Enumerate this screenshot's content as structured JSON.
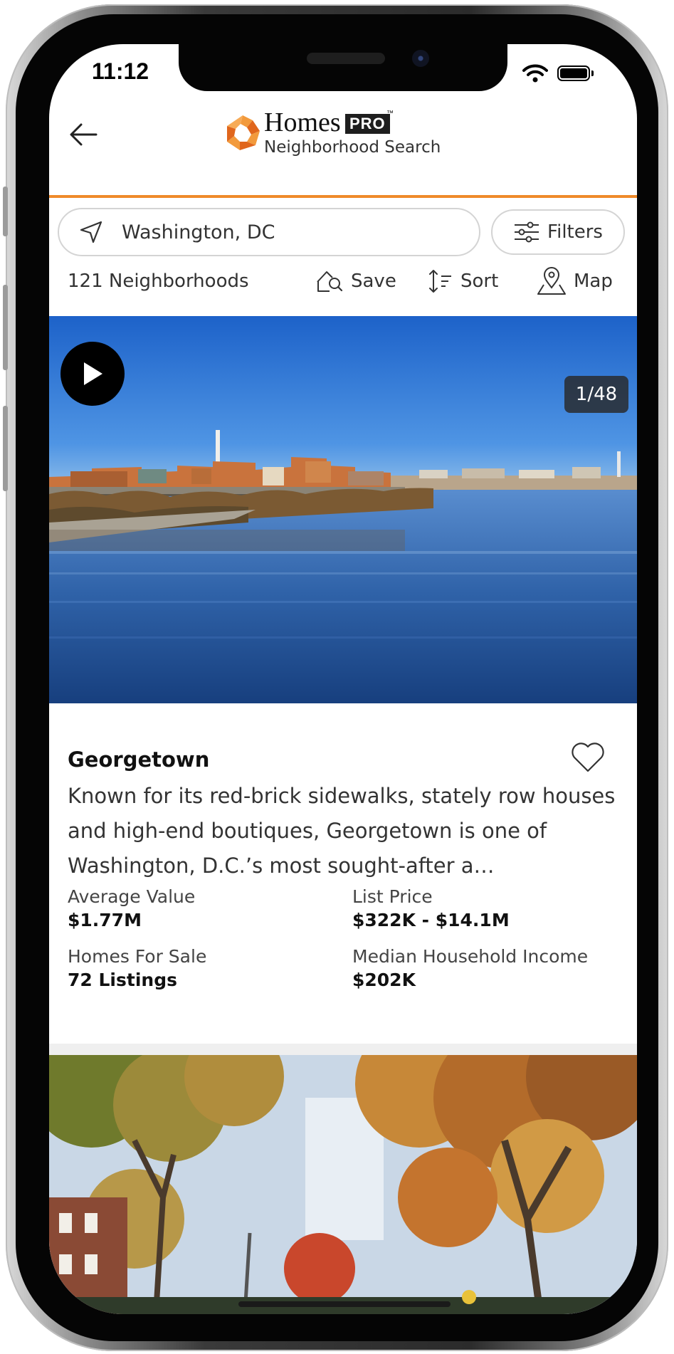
{
  "status_bar": {
    "time": "11:12"
  },
  "header": {
    "brand_name": "Homes",
    "brand_badge": "PRO",
    "brand_tm": "™",
    "subtitle": "Neighborhood Search"
  },
  "search": {
    "value": "Washington, DC",
    "filters_label": "Filters"
  },
  "toolbar": {
    "count": "121 Neighborhoods",
    "save_label": "Save",
    "sort_label": "Sort",
    "map_label": "Map"
  },
  "listing": {
    "photo_counter": "1/48",
    "name": "Georgetown",
    "description": "Known for its red-brick sidewalks, stately row houses and high-end boutiques, Georgetown is one of Washington, D.C.’s most sought-after a…",
    "stats": {
      "average_value_label": "Average Value",
      "average_value": "$1.77M",
      "list_price_label": "List Price",
      "list_price": "$322K - $14.1M",
      "homes_for_sale_label": "Homes For Sale",
      "homes_for_sale": "72 Listings",
      "median_income_label": "Median Household Income",
      "median_income": "$202K"
    }
  },
  "colors": {
    "accent": "#ef8a2a",
    "logo_dark": "#e0661c"
  },
  "icons": [
    "back-arrow-icon",
    "homes-logo-icon",
    "location-arrow-icon",
    "filters-sliders-icon",
    "save-search-icon",
    "sort-icon",
    "map-pin-icon",
    "play-icon",
    "heart-icon",
    "wifi-icon",
    "battery-icon"
  ]
}
